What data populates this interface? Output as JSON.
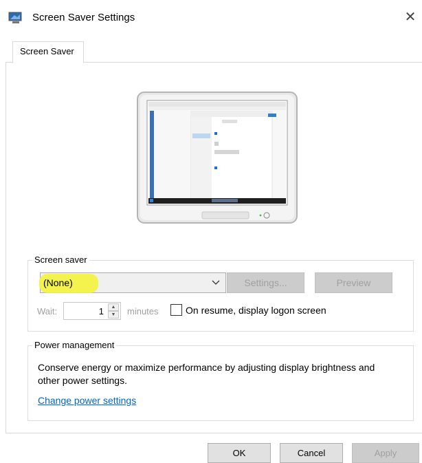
{
  "window": {
    "title": "Screen Saver Settings",
    "icon": "monitor-icon",
    "close_icon": "close-icon"
  },
  "tabs": [
    {
      "label": "Screen Saver",
      "active": true
    }
  ],
  "screen_saver": {
    "group_label": "Screen saver",
    "selected": "(None)",
    "settings_label": "Settings...",
    "preview_label": "Preview",
    "wait_label": "Wait:",
    "wait_value": "1",
    "minutes_label": "minutes",
    "resume_label": "On resume, display logon screen",
    "resume_checked": false
  },
  "power": {
    "group_label": "Power management",
    "description": "Conserve energy or maximize performance by adjusting display brightness and other power settings.",
    "link_label": "Change power settings"
  },
  "footer": {
    "ok_label": "OK",
    "cancel_label": "Cancel",
    "apply_label": "Apply"
  },
  "colors": {
    "highlight": "#f4f23a",
    "link": "#0066cc",
    "disabled_text": "#a0a0a0"
  }
}
